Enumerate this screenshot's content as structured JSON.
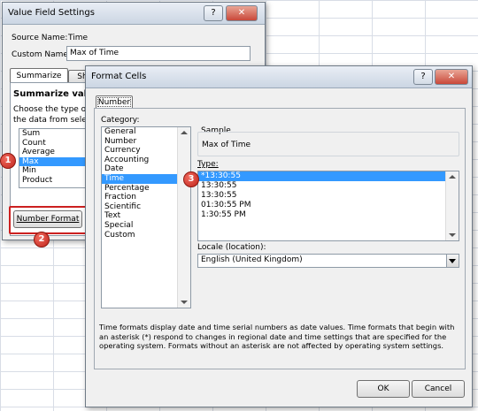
{
  "value_field_dialog": {
    "title": "Value Field Settings",
    "help_btn": "?",
    "close_btn": "✕",
    "source_name_label": "Source Name:",
    "source_name_value": "Time",
    "custom_name_label": "Custom Name:",
    "custom_name_value": "Max of Time",
    "tabs": [
      "Summarize by",
      "Sh"
    ],
    "summarize_heading": "Summarize valu",
    "desc_line1": "Choose the type o",
    "desc_line2": "the data from sele",
    "functions": [
      "Sum",
      "Count",
      "Average",
      "Max",
      "Min",
      "Product"
    ],
    "selected_function": "Max",
    "number_format_button": "Number Format"
  },
  "format_cells_dialog": {
    "title": "Format Cells",
    "help_btn": "?",
    "close_btn": "✕",
    "tab": "Number",
    "category_label": "Category:",
    "categories": [
      "General",
      "Number",
      "Currency",
      "Accounting",
      "Date",
      "Time",
      "Percentage",
      "Fraction",
      "Scientific",
      "Text",
      "Special",
      "Custom"
    ],
    "selected_category": "Time",
    "sample_label": "Sample",
    "sample_value": "Max of Time",
    "type_label": "Type:",
    "types": [
      "*13:30:55",
      "13:30:55",
      "13:30:55",
      "01:30:55 PM",
      "1:30:55 PM"
    ],
    "locale_label": "Locale (location):",
    "locale_value": "English (United Kingdom)",
    "description": "Time formats display date and time serial numbers as date values.  Time formats that begin with an asterisk (*) respond to changes in regional date and time settings that are specified for the operating system. Formats without an asterisk are not affected by operating system settings.",
    "ok_button": "OK",
    "cancel_button": "Cancel"
  },
  "callouts": [
    "1",
    "2",
    "3"
  ],
  "colors": {
    "selection": "#3399ff",
    "callout": "#c0241b",
    "highlight_box": "#cc2020"
  }
}
